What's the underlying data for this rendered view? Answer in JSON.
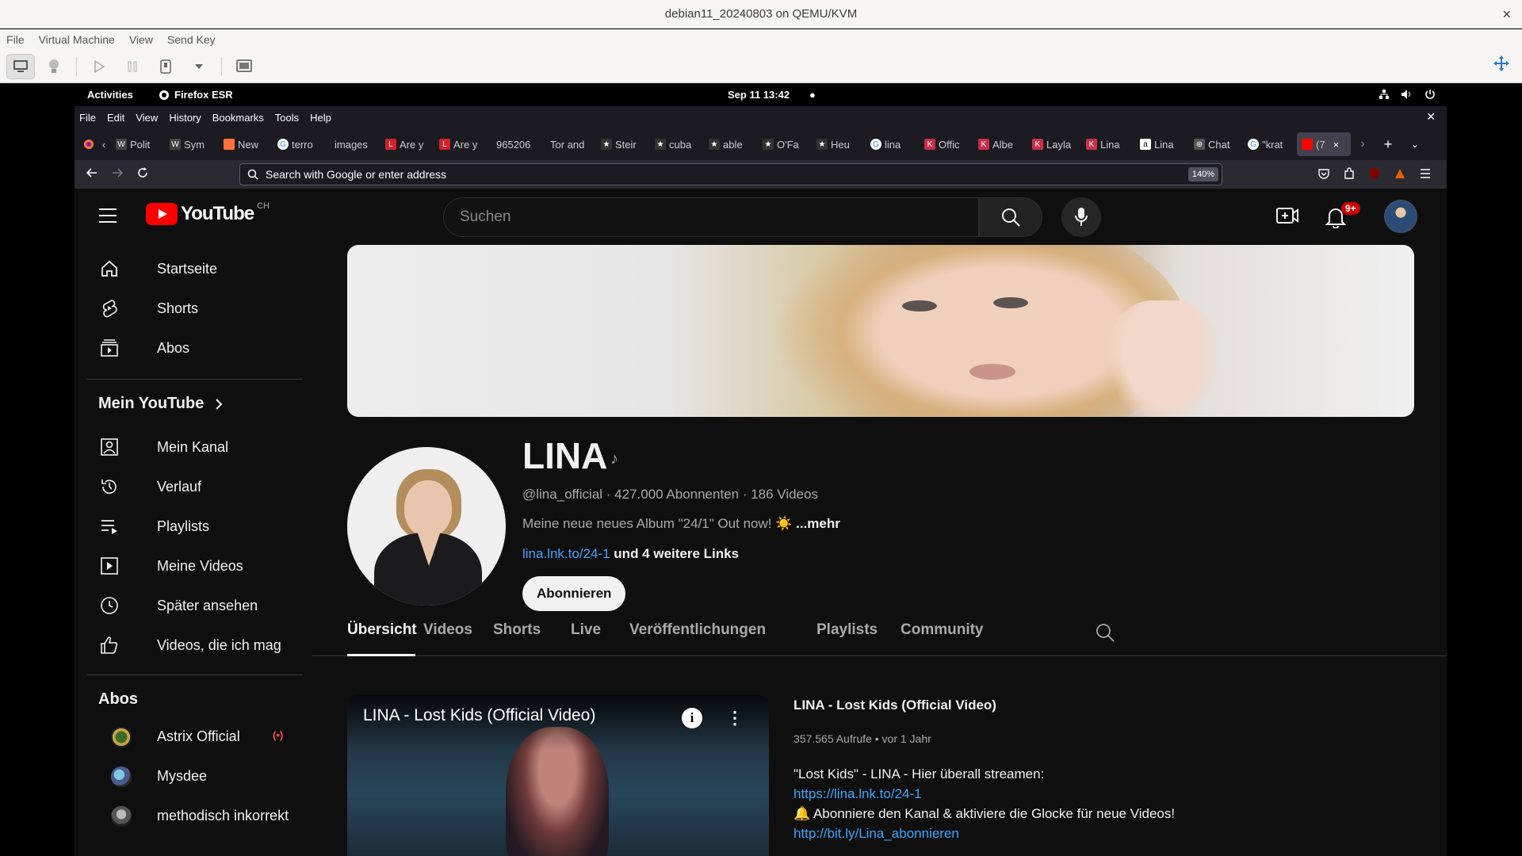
{
  "qemu": {
    "title": "debian11_20240803 on QEMU/KVM",
    "menu": [
      "File",
      "Virtual Machine",
      "View",
      "Send Key"
    ]
  },
  "gnome": {
    "activities": "Activities",
    "app": "Firefox ESR",
    "clock": "Sep 11  13:42",
    "dot": "●"
  },
  "firefox": {
    "menu": [
      "File",
      "Edit",
      "View",
      "History",
      "Bookmarks",
      "Tools",
      "Help"
    ],
    "tabs": [
      {
        "label": "Polit",
        "icon": "W"
      },
      {
        "label": "Sym",
        "icon": "W"
      },
      {
        "label": "New",
        "icon": "firefox"
      },
      {
        "label": "terro",
        "icon": "G"
      },
      {
        "label": "images",
        "icon": ""
      },
      {
        "label": "Are y",
        "icon": "LJ"
      },
      {
        "label": "Are y",
        "icon": "LJ"
      },
      {
        "label": "965206",
        "icon": ""
      },
      {
        "label": "Tor and",
        "icon": ""
      },
      {
        "label": "Steir",
        "icon": "★"
      },
      {
        "label": "cuba",
        "icon": "★"
      },
      {
        "label": "able",
        "icon": "★"
      },
      {
        "label": "O'Fa",
        "icon": "★"
      },
      {
        "label": "Heu",
        "icon": "★"
      },
      {
        "label": "lina",
        "icon": "G"
      },
      {
        "label": "Offic",
        "icon": "K"
      },
      {
        "label": "Albe",
        "icon": "K"
      },
      {
        "label": "Layla",
        "icon": "K"
      },
      {
        "label": "Lina",
        "icon": "K"
      },
      {
        "label": "Lina",
        "icon": "a"
      },
      {
        "label": "Chat",
        "icon": "⊛"
      },
      {
        "label": "\"krat",
        "icon": "G"
      },
      {
        "label": "(7",
        "icon": "yt"
      }
    ],
    "url_placeholder": "Search with Google or enter address",
    "zoom": "140%"
  },
  "youtube": {
    "country": "CH",
    "wordmark": "YouTube",
    "search_placeholder": "Suchen",
    "notifications": "9+",
    "sidebar": {
      "main": [
        {
          "label": "Startseite",
          "icon": "home-icon"
        },
        {
          "label": "Shorts",
          "icon": "shorts-icon"
        },
        {
          "label": "Abos",
          "icon": "subscriptions-icon"
        }
      ],
      "mein_youtube": "Mein YouTube",
      "you": [
        {
          "label": "Mein Kanal",
          "icon": "channel-icon"
        },
        {
          "label": "Verlauf",
          "icon": "history-icon"
        },
        {
          "label": "Playlists",
          "icon": "playlists-icon"
        },
        {
          "label": "Meine Videos",
          "icon": "my-videos-icon"
        },
        {
          "label": "Später ansehen",
          "icon": "watch-later-icon"
        },
        {
          "label": "Videos, die ich mag",
          "icon": "liked-icon"
        }
      ],
      "abos_heading": "Abos",
      "subscriptions": [
        {
          "label": "Astrix Official",
          "live": "(•)"
        },
        {
          "label": "Mysdee"
        },
        {
          "label": "methodisch inkorrekt"
        }
      ]
    },
    "channel": {
      "name": "LINA",
      "note_icon": "♪",
      "meta": "@lina_official · 427.000 Abonnenten · 186 Videos",
      "description": "Meine neue neues Album \"24/1\" Out now! ☀️ ",
      "more": "...mehr",
      "link": "lina.lnk.to/24-1",
      "extra_links": " und 4 weitere Links",
      "subscribe": "Abonnieren",
      "tabs": [
        "Übersicht",
        "Videos",
        "Shorts",
        "Live",
        "Veröffentlichungen",
        "Playlists",
        "Community"
      ]
    },
    "featured": {
      "player_title": "LINA - Lost Kids (Official Video)",
      "info": "i",
      "more": "⋮",
      "title": "LINA - Lost Kids (Official Video)",
      "stats": "357.565 Aufrufe • vor 1 Jahr",
      "lines": [
        "\"Lost Kids\" -  LINA -  Hier überall streamen:",
        "https://lina.lnk.to/24-1",
        "🔔  Abonniere den Kanal & aktiviere die Glocke für neue Videos!",
        "http://bit.ly/Lina_abonnieren"
      ]
    }
  }
}
